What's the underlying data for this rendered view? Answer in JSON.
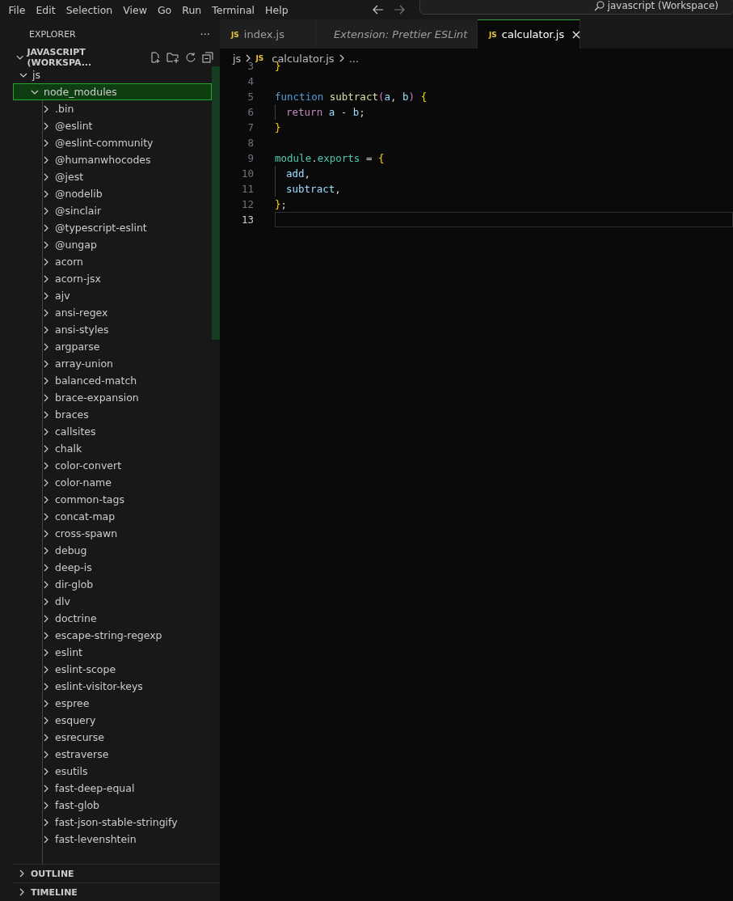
{
  "menu": [
    "File",
    "Edit",
    "Selection",
    "View",
    "Go",
    "Run",
    "Terminal",
    "Help"
  ],
  "command_center": {
    "value": "javascript (Workspace)"
  },
  "explorer": {
    "title": "EXPLORER",
    "more": "···",
    "workspace": {
      "label": "JAVASCRIPT (WORKSPA...",
      "expanded": true
    },
    "tree": [
      {
        "label": "js",
        "expanded": true,
        "selected": false,
        "children": [
          {
            "label": "node_modules",
            "expanded": true,
            "selected": true,
            "children": [
              {
                "label": ".bin",
                "expanded": false,
                "selected": false
              },
              {
                "label": "@eslint",
                "expanded": false,
                "selected": false
              },
              {
                "label": "@eslint-community",
                "expanded": false,
                "selected": false
              },
              {
                "label": "@humanwhocodes",
                "expanded": false,
                "selected": false
              },
              {
                "label": "@jest",
                "expanded": false,
                "selected": false
              },
              {
                "label": "@nodelib",
                "expanded": false,
                "selected": false
              },
              {
                "label": "@sinclair",
                "expanded": false,
                "selected": false
              },
              {
                "label": "@typescript-eslint",
                "expanded": false,
                "selected": false
              },
              {
                "label": "@ungap",
                "expanded": false,
                "selected": false
              },
              {
                "label": "acorn",
                "expanded": false,
                "selected": false
              },
              {
                "label": "acorn-jsx",
                "expanded": false,
                "selected": false
              },
              {
                "label": "ajv",
                "expanded": false,
                "selected": false
              },
              {
                "label": "ansi-regex",
                "expanded": false,
                "selected": false
              },
              {
                "label": "ansi-styles",
                "expanded": false,
                "selected": false
              },
              {
                "label": "argparse",
                "expanded": false,
                "selected": false
              },
              {
                "label": "array-union",
                "expanded": false,
                "selected": false
              },
              {
                "label": "balanced-match",
                "expanded": false,
                "selected": false
              },
              {
                "label": "brace-expansion",
                "expanded": false,
                "selected": false
              },
              {
                "label": "braces",
                "expanded": false,
                "selected": false
              },
              {
                "label": "callsites",
                "expanded": false,
                "selected": false
              },
              {
                "label": "chalk",
                "expanded": false,
                "selected": false
              },
              {
                "label": "color-convert",
                "expanded": false,
                "selected": false
              },
              {
                "label": "color-name",
                "expanded": false,
                "selected": false
              },
              {
                "label": "common-tags",
                "expanded": false,
                "selected": false
              },
              {
                "label": "concat-map",
                "expanded": false,
                "selected": false
              },
              {
                "label": "cross-spawn",
                "expanded": false,
                "selected": false
              },
              {
                "label": "debug",
                "expanded": false,
                "selected": false
              },
              {
                "label": "deep-is",
                "expanded": false,
                "selected": false
              },
              {
                "label": "dir-glob",
                "expanded": false,
                "selected": false
              },
              {
                "label": "dlv",
                "expanded": false,
                "selected": false
              },
              {
                "label": "doctrine",
                "expanded": false,
                "selected": false
              },
              {
                "label": "escape-string-regexp",
                "expanded": false,
                "selected": false
              },
              {
                "label": "eslint",
                "expanded": false,
                "selected": false
              },
              {
                "label": "eslint-scope",
                "expanded": false,
                "selected": false
              },
              {
                "label": "eslint-visitor-keys",
                "expanded": false,
                "selected": false
              },
              {
                "label": "espree",
                "expanded": false,
                "selected": false
              },
              {
                "label": "esquery",
                "expanded": false,
                "selected": false
              },
              {
                "label": "esrecurse",
                "expanded": false,
                "selected": false
              },
              {
                "label": "estraverse",
                "expanded": false,
                "selected": false
              },
              {
                "label": "esutils",
                "expanded": false,
                "selected": false
              },
              {
                "label": "fast-deep-equal",
                "expanded": false,
                "selected": false
              },
              {
                "label": "fast-glob",
                "expanded": false,
                "selected": false
              },
              {
                "label": "fast-json-stable-stringify",
                "expanded": false,
                "selected": false
              },
              {
                "label": "fast-levenshtein",
                "expanded": false,
                "selected": false
              }
            ]
          }
        ]
      }
    ],
    "panels": [
      {
        "label": "OUTLINE",
        "expanded": false
      },
      {
        "label": "TIMELINE",
        "expanded": false
      }
    ]
  },
  "tabs": [
    {
      "label": "index.js",
      "kind": "js",
      "icon_text": "JS",
      "selected": false,
      "preview": false
    },
    {
      "label": "Extension: Prettier ESLint",
      "kind": "extension",
      "selected": false,
      "preview": true
    },
    {
      "label": "calculator.js",
      "kind": "js",
      "icon_text": "JS",
      "selected": true,
      "preview": false,
      "close": "×"
    }
  ],
  "breadcrumb": [
    {
      "label": "js",
      "kind": "folder"
    },
    {
      "label": "calculator.js",
      "kind": "js",
      "icon_text": "JS"
    },
    {
      "label": "...",
      "kind": "more"
    }
  ],
  "editor": {
    "lines": [
      {
        "number": "3",
        "current": false,
        "tokens": [
          {
            "text": "}",
            "kind": "brace"
          }
        ]
      },
      {
        "number": "4",
        "current": false
      },
      {
        "number": "5",
        "current": false,
        "tokens": [
          {
            "text": "function ",
            "kind": "keyword"
          },
          {
            "text": "subtract",
            "kind": "func"
          },
          {
            "text": "(",
            "kind": "brace2"
          },
          {
            "text": "a",
            "kind": "param"
          },
          {
            "text": ", ",
            "kind": "plain"
          },
          {
            "text": "b",
            "kind": "param"
          },
          {
            "text": ")",
            "kind": "brace2"
          },
          {
            "text": " {",
            "kind": "brace"
          }
        ]
      },
      {
        "number": "6",
        "current": false,
        "indent": true,
        "tokens": [
          {
            "text": "return ",
            "kind": "control"
          },
          {
            "text": "a",
            "kind": "param"
          },
          {
            "text": " - ",
            "kind": "plain"
          },
          {
            "text": "b",
            "kind": "param"
          },
          {
            "text": ";",
            "kind": "plain"
          }
        ]
      },
      {
        "number": "7",
        "current": false,
        "tokens": [
          {
            "text": "}",
            "kind": "brace"
          }
        ]
      },
      {
        "number": "8",
        "current": false
      },
      {
        "number": "9",
        "current": false,
        "tokens": [
          {
            "text": "module",
            "kind": "type"
          },
          {
            "text": ".",
            "kind": "plain"
          },
          {
            "text": "exports",
            "kind": "type"
          },
          {
            "text": " = ",
            "kind": "plain"
          },
          {
            "text": "{",
            "kind": "brace"
          }
        ]
      },
      {
        "number": "10",
        "current": false,
        "indent": true,
        "tokens": [
          {
            "text": "add",
            "kind": "param"
          },
          {
            "text": ",",
            "kind": "plain"
          }
        ]
      },
      {
        "number": "11",
        "current": false,
        "indent": true,
        "tokens": [
          {
            "text": "subtract",
            "kind": "param"
          },
          {
            "text": ",",
            "kind": "plain"
          }
        ]
      },
      {
        "number": "12",
        "current": false,
        "tokens": [
          {
            "text": "}",
            "kind": "brace"
          },
          {
            "text": ";",
            "kind": "plain"
          }
        ]
      },
      {
        "number": "13",
        "current": true
      }
    ]
  }
}
